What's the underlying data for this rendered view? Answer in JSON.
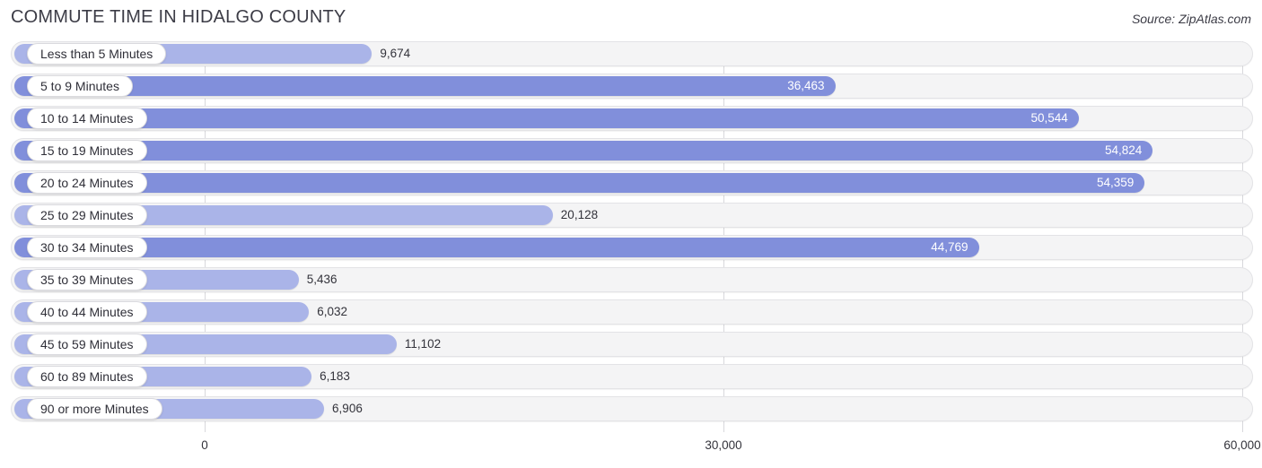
{
  "header": {
    "title": "COMMUTE TIME IN HIDALGO COUNTY",
    "source": "Source: ZipAtlas.com"
  },
  "colors": {
    "bar_light": "#aab4e8",
    "bar_dark": "#818fdb",
    "track": "#f4f4f5",
    "gridline": "#d8d8dc",
    "text": "#33333b"
  },
  "axis": {
    "ticks": [
      {
        "label": "0",
        "value": 0
      },
      {
        "label": "30,000",
        "value": 30000
      },
      {
        "label": "60,000",
        "value": 60000
      }
    ]
  },
  "chart_data": {
    "type": "bar",
    "orientation": "horizontal",
    "title": "COMMUTE TIME IN HIDALGO COUNTY",
    "subtitle": "",
    "xlabel": "",
    "ylabel": "",
    "xlim": [
      0,
      60000
    ],
    "grid": true,
    "legend": null,
    "source": "Source: ZipAtlas.com",
    "categories": [
      "Less than 5 Minutes",
      "5 to 9 Minutes",
      "10 to 14 Minutes",
      "15 to 19 Minutes",
      "20 to 24 Minutes",
      "25 to 29 Minutes",
      "30 to 34 Minutes",
      "35 to 39 Minutes",
      "40 to 44 Minutes",
      "45 to 59 Minutes",
      "60 to 89 Minutes",
      "90 or more Minutes"
    ],
    "values": [
      9674,
      36463,
      50544,
      54824,
      54359,
      20128,
      44769,
      5436,
      6032,
      11102,
      6183,
      6906
    ],
    "value_labels": [
      "9,674",
      "36,463",
      "50,544",
      "54,824",
      "54,359",
      "20,128",
      "44,769",
      "5,436",
      "6,032",
      "11,102",
      "6,183",
      "6,906"
    ],
    "label_placement": [
      "outside",
      "inside",
      "inside",
      "inside",
      "inside",
      "outside",
      "inside",
      "outside",
      "outside",
      "outside",
      "outside",
      "outside"
    ],
    "bar_shades": [
      "light",
      "dark",
      "dark",
      "dark",
      "dark",
      "light",
      "dark",
      "light",
      "light",
      "light",
      "light",
      "light"
    ]
  }
}
